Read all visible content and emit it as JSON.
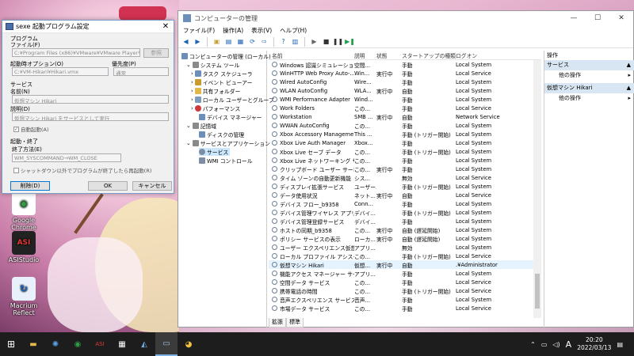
{
  "desktop": {
    "icons": [
      {
        "label": "Google Chrome",
        "glyph": "◉",
        "color": "#2f9e44"
      },
      {
        "label": "ASIStudio",
        "glyph": "ASI",
        "color": "#d32f2f"
      },
      {
        "label": "Macrium Reflect",
        "glyph": "↻",
        "color": "#1565c0"
      }
    ]
  },
  "dialog": {
    "title": "sexe 起動プログラム設定",
    "close": "✕",
    "program_label": "プログラム",
    "file_label": "ファイル(F)",
    "file_value": "C:¥Program Files (x86)¥VMware¥VMware Player¥vm",
    "browse_label": "参照",
    "options_label": "起動時オプション(O)",
    "options_value": "C:¥VM-Hikari¥Hikari.vmx",
    "priority_label": "優先度(P)",
    "priority_value": "通常",
    "service_label": "サービス",
    "name_label": "名前(N)",
    "name_value": "仮想マシン Hikari",
    "desc_label": "説明(D)",
    "desc_value": "仮想マシン Hikari をサービスとして実行",
    "autostart_label": "自動起動(A)",
    "startstop_label": "起動・終了",
    "end_method_label": "終了方法(E)",
    "end_method_value": "WM_SYSCOMMAND→WM_CLOSE",
    "restart_label": "シャットダウン以外でプログラムが終了したら再起動(R)",
    "delete_btn": "削除(D)",
    "ok_btn": "OK",
    "cancel_btn": "キャンセル"
  },
  "mmc": {
    "title": "コンピューターの管理",
    "controls": [
      "—",
      "☐",
      "✕"
    ],
    "menu": [
      "ファイル(F)",
      "操作(A)",
      "表示(V)",
      "ヘルプ(H)"
    ],
    "tree": [
      {
        "label": "コンピューターの管理 (ローカル)",
        "color": "#6b8fb9"
      },
      {
        "label": "システム ツール",
        "color": "#8a8a8a"
      },
      {
        "label": "タスク スケジューラ",
        "color": "#6b8fb9"
      },
      {
        "label": "イベント ビューアー",
        "color": "#c99b2f"
      },
      {
        "label": "共有フォルダー",
        "color": "#e0b84a"
      },
      {
        "label": "ローカル ユーザーとグループ",
        "color": "#7c9bbd"
      },
      {
        "label": "パフォーマンス",
        "color": "#cc3b3b"
      },
      {
        "label": "デバイス マネージャー",
        "color": "#6b8fb9"
      },
      {
        "label": "記憶域",
        "color": "#8a8a8a"
      },
      {
        "label": "ディスクの管理",
        "color": "#6b8fb9"
      },
      {
        "label": "サービスとアプリケーション",
        "color": "#8a8a8a"
      },
      {
        "label": "サービス",
        "color": "#7c8ea4"
      },
      {
        "label": "WMI コントロール",
        "color": "#7c8ea4"
      }
    ],
    "columns": [
      "名前",
      "説明",
      "状態",
      "スタートアップの種類",
      "ログオン"
    ],
    "rows": [
      [
        "Windows 認識シミュレーション...",
        "空間...",
        "",
        "手動",
        "Local System"
      ],
      [
        "WinHTTP Web Proxy Auto-...",
        "Win...",
        "実行中",
        "手動",
        "Local Service"
      ],
      [
        "Wired AutoConfig",
        "Wire...",
        "",
        "手動",
        "Local System"
      ],
      [
        "WLAN AutoConfig",
        "WLA...",
        "実行中",
        "自動",
        "Local System"
      ],
      [
        "WMI Performance Adapter",
        "Wind...",
        "",
        "手動",
        "Local System"
      ],
      [
        "Work Folders",
        "この...",
        "",
        "手動",
        "Local Service"
      ],
      [
        "Workstation",
        "SMB ...",
        "実行中",
        "自動",
        "Network Service"
      ],
      [
        "WWAN AutoConfig",
        "この...",
        "",
        "手動",
        "Local System"
      ],
      [
        "Xbox Accessory Manageme...",
        "This ...",
        "",
        "手動 (トリガー開始)",
        "Local System"
      ],
      [
        "Xbox Live Auth Manager",
        "Xbox...",
        "",
        "手動",
        "Local System"
      ],
      [
        "Xbox Live セーブ データ",
        "この...",
        "",
        "手動 (トリガー開始)",
        "Local System"
      ],
      [
        "Xbox Live ネットワーキング サ...",
        "この...",
        "",
        "手動",
        "Local System"
      ],
      [
        "クリップボード ユーザー サービス...",
        "この...",
        "実行中",
        "手動",
        "Local System"
      ],
      [
        "タイム ゾーンの自動更新機能",
        "シス...",
        "",
        "無効",
        "Local Service"
      ],
      [
        "ディスプレイ拡張サービス",
        "ユーザー...",
        "",
        "手動 (トリガー開始)",
        "Local System"
      ],
      [
        "データ使用状況",
        "ネット...",
        "実行中",
        "自動",
        "Local Service"
      ],
      [
        "デバイス フロー_b9358",
        "Conn...",
        "",
        "手動",
        "Local System"
      ],
      [
        "デバイス管理ワイヤレス アプリケ...",
        "デバイ...",
        "",
        "手動 (トリガー開始)",
        "Local System"
      ],
      [
        "デバイス管理登録サービス",
        "デバイ...",
        "",
        "手動",
        "Local System"
      ],
      [
        "ホストの同期_b9358",
        "この...",
        "実行中",
        "自動 (遅延開始)",
        "Local System"
      ],
      [
        "ポリシー サービスの表示",
        "ローカ...",
        "実行中",
        "自動 (遅延開始)",
        "Local System"
      ],
      [
        "ユーザー エクスペリエンス仮想化...",
        "アプリ...",
        "",
        "無効",
        "Local System"
      ],
      [
        "ローカル プロファイル アシスタン...",
        "この...",
        "",
        "手動 (トリガー開始)",
        "Local Service"
      ],
      [
        "仮想マシン Hikari",
        "仮想...",
        "実行中",
        "自動",
        ".¥Administrator"
      ],
      [
        "機能アクセス マネージャー サービス",
        "アプリ...",
        "",
        "手動",
        "Local System"
      ],
      [
        "空間データ サービス",
        "この...",
        "",
        "手動",
        "Local Service"
      ],
      [
        "携帯電話の時間",
        "この...",
        "",
        "手動 (トリガー開始)",
        "Local Service"
      ],
      [
        "音声エクスペリエンス サービス",
        "音声...",
        "",
        "手動",
        "Local System"
      ],
      [
        "市場データ サービス",
        "この...",
        "",
        "手動",
        "Local Service"
      ]
    ],
    "selected_row": 23,
    "tabs": [
      "拡張",
      "標準"
    ],
    "actions": {
      "header": "操作",
      "section1": "サービス",
      "item1": "他の操作",
      "section2": "仮想マシン Hikari",
      "item2": "他の操作"
    }
  },
  "taskbar": {
    "tray_lang": "A",
    "time": "20:20",
    "date": "2022/03/13"
  }
}
